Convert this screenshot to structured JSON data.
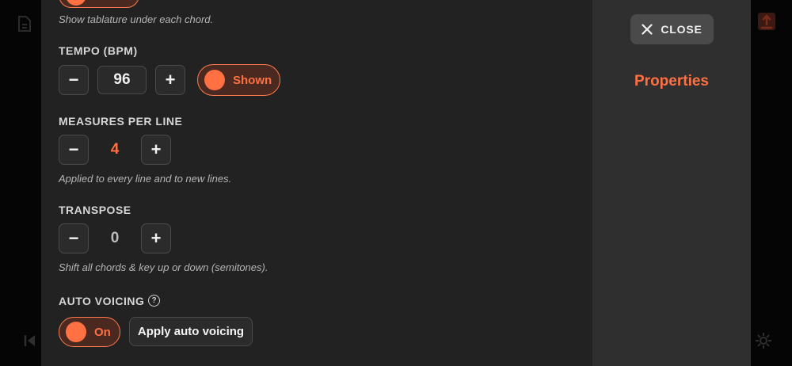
{
  "colors": {
    "accent": "#ff7043",
    "panel_bg": "#222222",
    "side_panel_bg": "#2f2f2f"
  },
  "tablature": {
    "hint": "Show tablature under each chord."
  },
  "tempo": {
    "title": "TEMPO (BPM)",
    "decrement_label": "−",
    "value": "96",
    "increment_label": "+",
    "toggle_label": "Shown"
  },
  "measures": {
    "title": "MEASURES PER LINE",
    "decrement_label": "−",
    "value": "4",
    "increment_label": "+",
    "hint": "Applied to every line and to new lines."
  },
  "transpose": {
    "title": "TRANSPOSE",
    "decrement_label": "−",
    "value": "0",
    "increment_label": "+",
    "hint": "Shift all chords & key up or down (semitones)."
  },
  "auto_voicing": {
    "title": "AUTO VOICING",
    "help_glyph": "?",
    "toggle_label": "On",
    "apply_label": "Apply auto voicing"
  },
  "side_panel": {
    "close_label": "CLOSE",
    "title": "Properties"
  }
}
